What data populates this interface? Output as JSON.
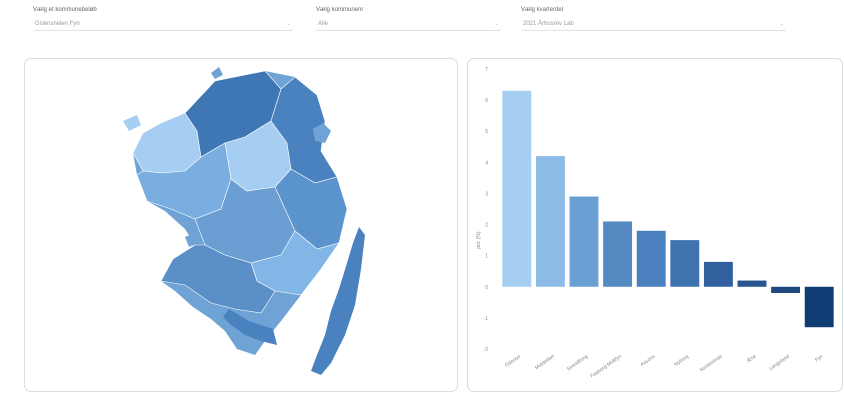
{
  "filters": [
    {
      "label": "Vælg et kommunebeløb",
      "value": "Grænsnelen Fyn",
      "chevron": "chevron-down-icon"
    },
    {
      "label": "Vælg kommunenr",
      "value": "Alle",
      "chevron": "chevron-down-icon"
    },
    {
      "label": "Vælg kvarterdel",
      "value": "2021 Århusrev Lab",
      "chevron": "chevron-down-icon"
    }
  ],
  "colors": {
    "map_light": "#a6cdf2",
    "map_mid": "#6fa3d6",
    "map_dark": "#3f77b4",
    "bar_scale": [
      "#a6cdf2",
      "#8dbbe8",
      "#6a9fd4",
      "#5489c2",
      "#4a80bd",
      "#3f73b0",
      "#30619e",
      "#28558f",
      "#1f4a80",
      "#0f3d73"
    ]
  },
  "chart_data": {
    "type": "bar",
    "categories": [
      "Odense",
      "Middelfart",
      "Svendborg",
      "Faaborg-Midtfyn",
      "Assens",
      "Nyborg",
      "Kerteminde",
      "Ærø",
      "Langeland",
      "Fyn"
    ],
    "values": [
      6.3,
      4.2,
      2.9,
      2.1,
      1.8,
      1.5,
      0.8,
      0.2,
      -0.2,
      -1.3
    ],
    "ylim": [
      -2,
      7
    ],
    "yticks": [
      -2,
      -1,
      0,
      1,
      2,
      3,
      4,
      5,
      6,
      7
    ],
    "ylabel": "pct. (%)",
    "title": "",
    "xlabel": ""
  }
}
